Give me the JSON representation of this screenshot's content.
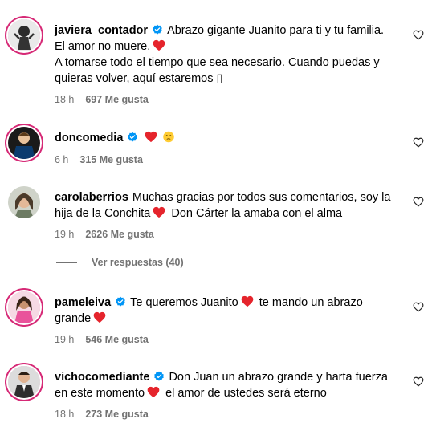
{
  "comments": [
    {
      "username": "javiera_contador",
      "verified": true,
      "avatar_icon": "profile-photo",
      "lines": [
        "Abrazo gigante Juanito para ti y tu familia.",
        "El amor no muere.",
        "A tomarse todo el tiempo que sea necesario. Cuando puedas y quieras volver, aquí estaremos",
        "▯"
      ],
      "time": "18 h",
      "likes": "697 Me gusta"
    },
    {
      "username": "doncomedia",
      "verified": true,
      "avatar_icon": "profile-photo",
      "time": "6 h",
      "likes": "315 Me gusta"
    },
    {
      "username": "carolaberrios",
      "verified": false,
      "avatar_icon": "profile-photo",
      "text_part1": "Muchas gracias por todos sus comentarios, soy la hija de la Conchita",
      "text_part2": "Don Cárter la amaba con el alma",
      "time": "19 h",
      "likes": "2626 Me gusta"
    },
    {
      "username": "pameleiva",
      "verified": true,
      "avatar_icon": "profile-photo",
      "text_part1": "Te queremos Juanito",
      "text_part2": "te mando un abrazo grande",
      "time": "19 h",
      "likes": "546 Me gusta"
    },
    {
      "username": "vichocomediante",
      "verified": true,
      "avatar_icon": "profile-photo",
      "text_part1": "Don Juan un abrazo grande y harta fuerza en este momento",
      "text_part2": "el amor de ustedes será eterno",
      "time": "18 h",
      "likes": "273 Me gusta"
    }
  ],
  "replies_toggle": "Ver respuestas (40)",
  "colors": {
    "heart": "#e5242c",
    "verified": "#0095f6",
    "meta": "#737373"
  }
}
